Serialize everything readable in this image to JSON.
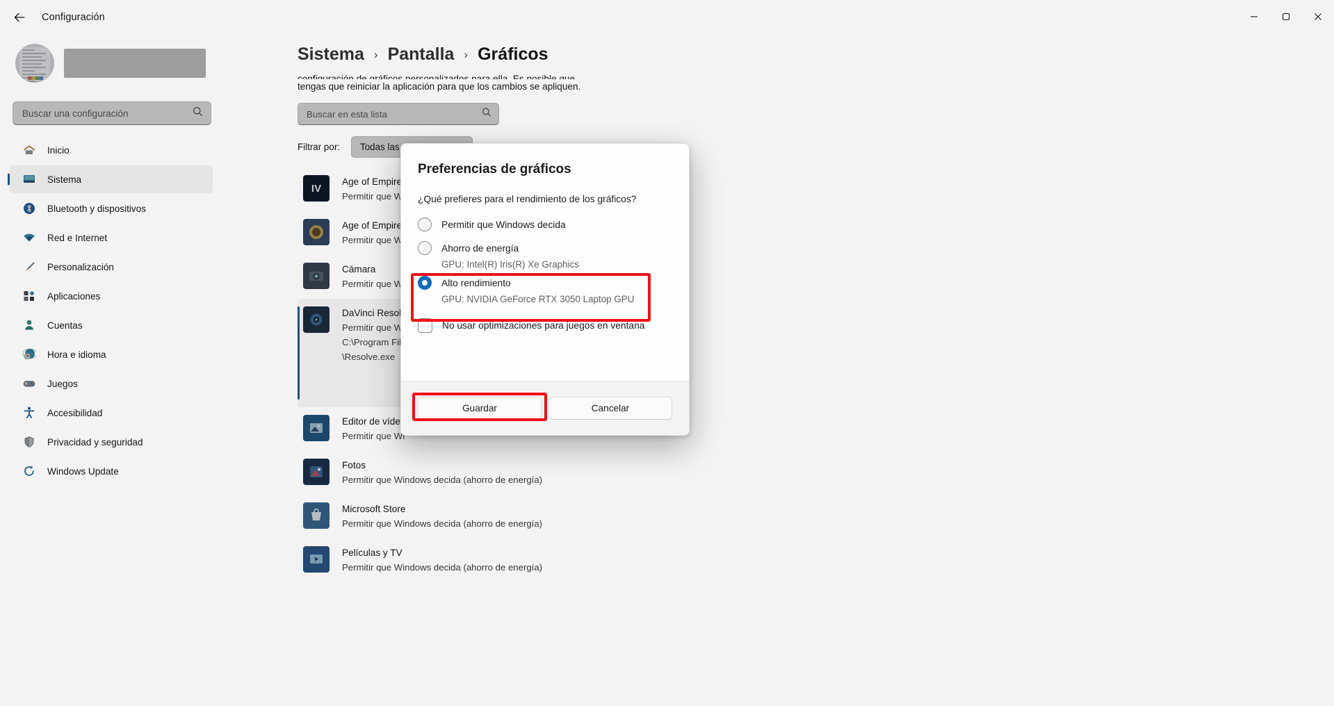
{
  "window": {
    "title": "Configuración",
    "back_icon": "back-arrow-icon",
    "minimize_icon": "minimize-icon",
    "maximize_icon": "maximize-icon",
    "close_icon": "close-icon"
  },
  "sidebar": {
    "search_placeholder": "Buscar una configuración",
    "search_value": "",
    "search_icon": "search-icon",
    "profile_name_redacted": "",
    "items": [
      {
        "label": "Inicio",
        "icon": "home-icon",
        "active": false
      },
      {
        "label": "Sistema",
        "icon": "system-monitor-icon",
        "active": true
      },
      {
        "label": "Bluetooth y dispositivos",
        "icon": "bluetooth-icon",
        "active": false
      },
      {
        "label": "Red e Internet",
        "icon": "wifi-icon",
        "active": false
      },
      {
        "label": "Personalización",
        "icon": "paintbrush-icon",
        "active": false
      },
      {
        "label": "Aplicaciones",
        "icon": "apps-icon",
        "active": false
      },
      {
        "label": "Cuentas",
        "icon": "person-icon",
        "active": false
      },
      {
        "label": "Hora e idioma",
        "icon": "clock-globe-icon",
        "active": false
      },
      {
        "label": "Juegos",
        "icon": "gamepad-icon",
        "active": false
      },
      {
        "label": "Accesibilidad",
        "icon": "accessibility-icon",
        "active": false
      },
      {
        "label": "Privacidad y seguridad",
        "icon": "shield-icon",
        "active": false
      },
      {
        "label": "Windows Update",
        "icon": "update-icon",
        "active": false
      }
    ]
  },
  "breadcrumb": {
    "items": [
      "Sistema",
      "Pantalla",
      "Gráficos"
    ],
    "separator": "›"
  },
  "main": {
    "description_line1": "configuración de gráficos personalizados para ella. Es posible que",
    "description_line2": "tengas que reiniciar la aplicación para que los cambios se apliquen.",
    "list_search_placeholder": "Buscar en esta lista",
    "list_search_value": "",
    "list_search_icon": "search-icon",
    "filter_label": "Filtrar por:",
    "filter_value": "Todas las aplicaciones",
    "filter_chevron_icon": "chevron-down-icon",
    "apps": [
      {
        "name": "Age of Empires",
        "sub": "Permitir que Wi",
        "sub2": "",
        "sub3": "",
        "icon_text": "IV",
        "icon_bg": "#0b1b34",
        "selected": false
      },
      {
        "name": "Age of Empires",
        "sub": "Permitir que Wi",
        "sub2": "",
        "sub3": "",
        "icon_text": "",
        "icon_bg": "#2f4f7a",
        "selected": false
      },
      {
        "name": "Cámara",
        "sub": "Permitir que Wi",
        "sub2": "",
        "sub3": "",
        "icon_text": "",
        "icon_bg": "#3a4a5c",
        "selected": false
      },
      {
        "name": "DaVinci Resolve",
        "sub": "Permitir que Wi",
        "sub2": "C:\\Program File",
        "sub3": "\\Resolve.exe",
        "icon_text": "",
        "icon_bg": "#1b3350",
        "selected": true
      },
      {
        "name": "Editor de vídeo",
        "sub": "Permitir que Wi",
        "sub2": "",
        "sub3": "",
        "icon_text": "",
        "icon_bg": "#12609e",
        "selected": false
      },
      {
        "name": "Fotos",
        "sub": "Permitir que Windows decida (ahorro de energía)",
        "sub2": "",
        "sub3": "",
        "icon_text": "",
        "icon_bg": "#14365e",
        "selected": false
      },
      {
        "name": "Microsoft Store",
        "sub": "Permitir que Windows decida (ahorro de energía)",
        "sub2": "",
        "sub3": "",
        "icon_text": "",
        "icon_bg": "#2f6fb0",
        "selected": false
      },
      {
        "name": "Películas y TV",
        "sub": "Permitir que Windows decida (ahorro de energía)",
        "sub2": "",
        "sub3": "",
        "icon_text": "",
        "icon_bg": "#1f5fa8",
        "selected": false
      }
    ]
  },
  "dialog": {
    "title": "Preferencias de gráficos",
    "question": "¿Qué prefieres para el rendimiento de los gráficos?",
    "options": [
      {
        "label": "Permitir que Windows decida",
        "gpu": "",
        "checked": false
      },
      {
        "label": "Ahorro de energía",
        "gpu": "GPU: Intel(R) Iris(R) Xe Graphics",
        "checked": false
      },
      {
        "label": "Alto rendimiento",
        "gpu": "GPU: NVIDIA GeForce RTX 3050 Laptop GPU",
        "checked": true
      }
    ],
    "checkbox_label": "No usar optimizaciones para juegos en ventana",
    "checkbox_checked": false,
    "save_label": "Guardar",
    "cancel_label": "Cancelar"
  },
  "annotations": {
    "highlight_color": "#ee1018",
    "boxes": [
      "alto-rendimiento-option",
      "guardar-button"
    ]
  }
}
